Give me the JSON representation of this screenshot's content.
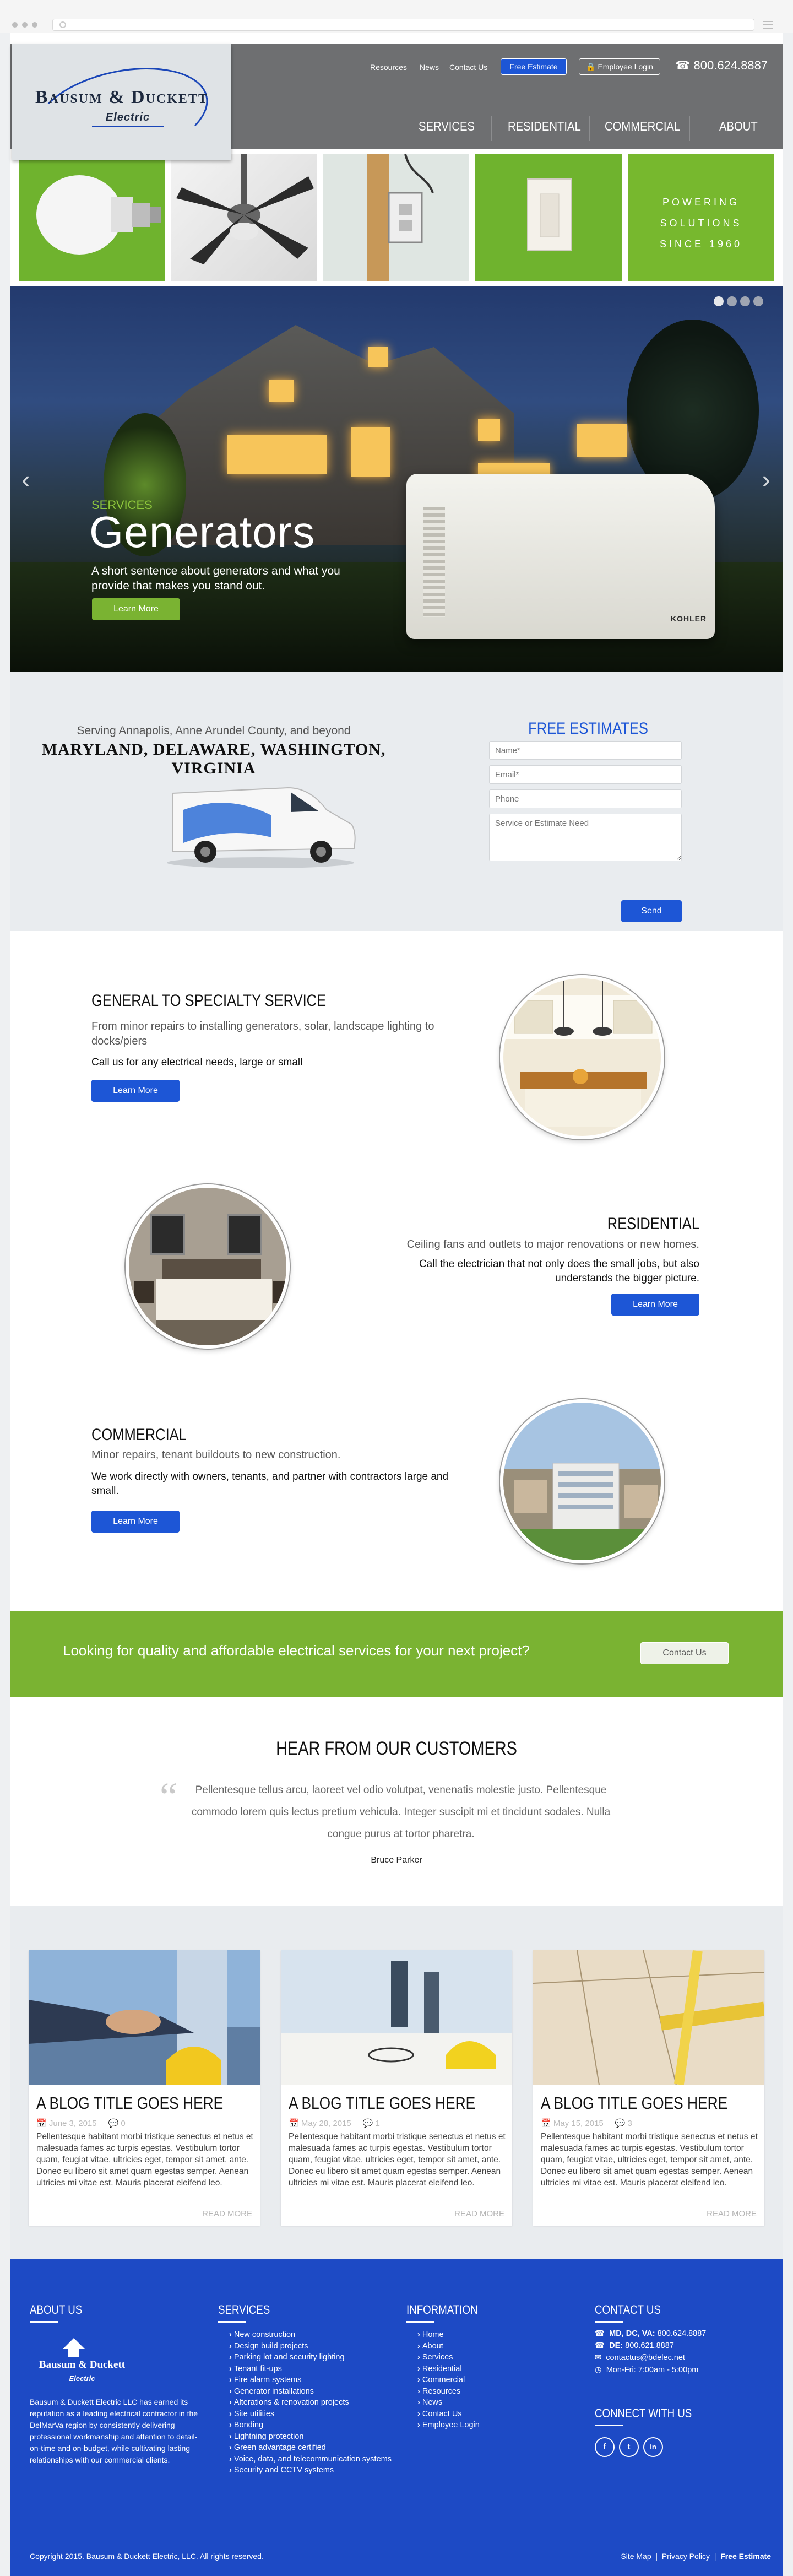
{
  "header": {
    "links": [
      "Resources",
      "News",
      "Contact Us"
    ],
    "free_estimate": "Free Estimate",
    "employee_login": "Employee Login",
    "phone": "800.624.8887",
    "logo_name": "Bausum & Duckett",
    "logo_sub": "Electric",
    "nav": [
      "SERVICES",
      "RESIDENTIAL",
      "COMMERCIAL",
      "ABOUT"
    ]
  },
  "strip": {
    "tagline_lines": [
      "POWERING",
      "SOLUTIONS",
      "SINCE 1960"
    ]
  },
  "hero": {
    "kicker": "SERVICES",
    "title": "Generators",
    "description": "A short sentence about generators and what you provide that makes you stand out.",
    "button": "Learn More",
    "brand_on_unit": "KOHLER",
    "slides": 4,
    "active_slide": 1
  },
  "estimate": {
    "serving": "Serving Annapolis, Anne Arundel County, and beyond",
    "states": "MARYLAND, DELAWARE, WASHINGTON, VIRGINIA",
    "form_title": "FREE ESTIMATES",
    "placeholders": {
      "name": "Name*",
      "email": "Email*",
      "phone": "Phone",
      "message": "Service or Estimate Need"
    },
    "send": "Send"
  },
  "services": [
    {
      "title": "GENERAL TO SPECIALTY SERVICE",
      "subtitle": "From minor repairs to installing generators, solar, landscape lighting to docks/piers",
      "text": "Call us for any electrical needs, large or small",
      "button": "Learn More"
    },
    {
      "title": "RESIDENTIAL",
      "subtitle": "Ceiling fans and outlets to major renovations or new homes.",
      "text": "Call the electrician that not only does the small jobs, but also understands the bigger picture.",
      "button": "Learn More"
    },
    {
      "title": "COMMERCIAL",
      "subtitle": "Minor repairs, tenant buildouts to new construction.",
      "text": "We work directly with owners, tenants, and partner with contractors large and small.",
      "button": "Learn More"
    }
  ],
  "band": {
    "text": "Looking for quality and affordable electrical services for your next project?",
    "button": "Contact Us"
  },
  "testimonials": {
    "title": "HEAR FROM OUR CUSTOMERS",
    "quote": "Pellentesque tellus arcu, laoreet vel odio volutpat, venenatis molestie justo. Pellentesque commodo lorem quis lectus pretium vehicula. Integer suscipit mi et tincidunt sodales. Nulla congue purus at tortor pharetra.",
    "author": "Bruce Parker"
  },
  "blog": [
    {
      "title": "A BLOG TITLE GOES HERE",
      "date": "June 3, 2015",
      "comments": "0",
      "body": "Pellentesque habitant morbi tristique senectus et netus et malesuada fames ac turpis egestas. Vestibulum tortor quam, feugiat vitae, ultricies eget, tempor sit amet, ante. Donec eu libero sit amet quam egestas semper. Aenean ultricies mi vitae est. Mauris placerat eleifend leo.",
      "more": "READ MORE"
    },
    {
      "title": "A BLOG TITLE GOES HERE",
      "date": "May 28, 2015",
      "comments": "1",
      "body": "Pellentesque habitant morbi tristique senectus et netus et malesuada fames ac turpis egestas. Vestibulum tortor quam, feugiat vitae, ultricies eget, tempor sit amet, ante. Donec eu libero sit amet quam egestas semper. Aenean ultricies mi vitae est. Mauris placerat eleifend leo.",
      "more": "READ MORE"
    },
    {
      "title": "A BLOG TITLE GOES HERE",
      "date": "May 15, 2015",
      "comments": "3",
      "body": "Pellentesque habitant morbi tristique senectus et netus et malesuada fames ac turpis egestas. Vestibulum tortor quam, feugiat vitae, ultricies eget, tempor sit amet, ante. Donec eu libero sit amet quam egestas semper. Aenean ultricies mi vitae est. Mauris placerat eleifend leo.",
      "more": "READ MORE"
    }
  ],
  "footer": {
    "about_title": "ABOUT US",
    "about_text": "Bausum & Duckett Electric LLC has earned its reputation as a leading electrical contractor in the DelMarVa region by consistently delivering professional workmanship and attention to detail-on-time and on-budget, while cultivating lasting relationships with our commercial clients.",
    "services_title": "SERVICES",
    "services": [
      "New construction",
      "Design build projects",
      "Parking lot and security lighting",
      "Tenant fit-ups",
      "Fire alarm systems",
      "Generator installations",
      "Alterations & renovation projects",
      "Site utilities",
      "Bonding",
      "Lightning protection",
      "Green advantage certified",
      "Voice, data, and telecommunication systems",
      "Security and CCTV systems"
    ],
    "info_title": "INFORMATION",
    "info": [
      "Home",
      "About",
      "Services",
      "Residential",
      "Commercial",
      "Resources",
      "News",
      "Contact Us",
      "Employee Login"
    ],
    "contact_title": "CONTACT US",
    "contact_rows": [
      {
        "label": "MD, DC, VA:",
        "value": "800.624.8887"
      },
      {
        "label": "DE:",
        "value": "800.621.8887"
      },
      {
        "label": "",
        "value": "contactus@bdelec.net"
      },
      {
        "label": "",
        "value": "Mon-Fri: 7:00am - 5:00pm"
      }
    ],
    "connect_title": "CONNECT WITH US",
    "social": [
      "f",
      "t",
      "in"
    ],
    "copyright": "Copyright 2015. Bausum & Duckett Electric, LLC. All rights reserved.",
    "bottom_links": [
      "Site Map",
      "Privacy Policy",
      "Free Estimate"
    ]
  },
  "colors": {
    "brand_blue": "#1d56d6",
    "footer_blue": "#1d4ac5",
    "brand_green": "#7ab332",
    "header_gray": "#6e6f71"
  }
}
